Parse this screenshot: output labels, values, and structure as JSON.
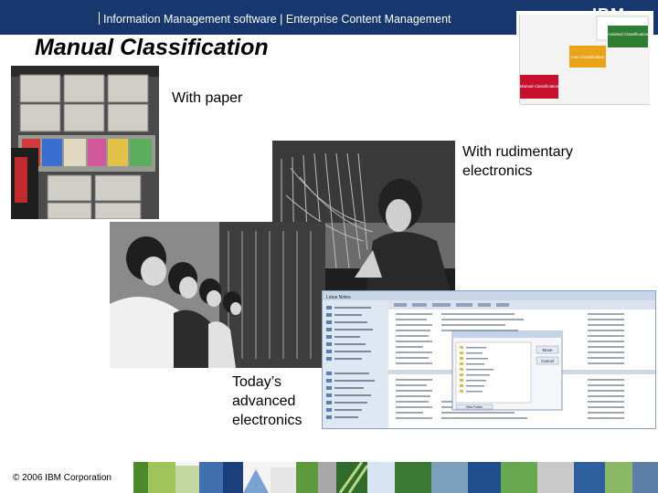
{
  "header": {
    "title": "Information Management software | Enterprise Content Management",
    "logo": "IBM",
    "background": "#16386f"
  },
  "slide": {
    "title": "Manual Classification"
  },
  "captions": {
    "paper": "With paper",
    "electronics_line1": "With rudimentary",
    "electronics_line2": "electronics",
    "advanced_line1": "Today’s",
    "advanced_line2": "advanced",
    "advanced_line3": "electronics"
  },
  "thumbnail_chart": {
    "box_top": "Auto Classification",
    "box_mid": "Assisted Classification",
    "box_low": "Manual Classification",
    "accent": "#c8102e"
  },
  "screenshot_window": {
    "title": "Lotus Notes",
    "dialog_button_move": "Move",
    "dialog_button_cancel": "Cancel",
    "dialog_button_new_folder": "New Folder"
  },
  "footer": {
    "copyright": "© 2006 IBM Corporation"
  }
}
